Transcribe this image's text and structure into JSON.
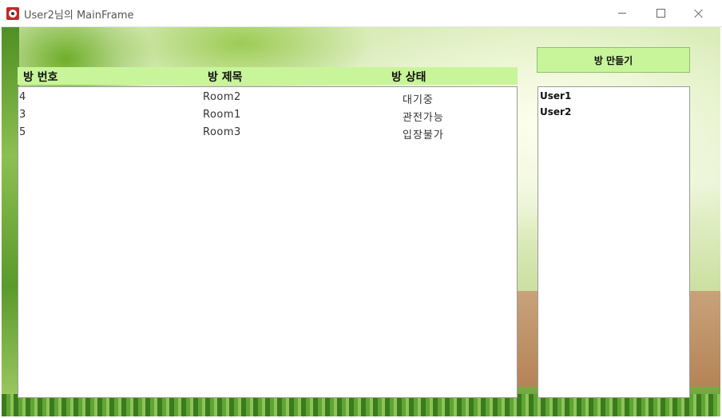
{
  "window": {
    "title": "User2님의 MainFrame",
    "icons": [
      "app-icon",
      "minimize-icon",
      "maximize-icon",
      "close-icon"
    ]
  },
  "room_table": {
    "headers": [
      "방 번호",
      "방 제목",
      "방 상태"
    ],
    "rows": [
      {
        "num": "4",
        "title": "Room2",
        "status": "대기중"
      },
      {
        "num": "3",
        "title": "Room1",
        "status": "관전가능"
      },
      {
        "num": "5",
        "title": "Room3",
        "status": "입장불가"
      }
    ]
  },
  "sidebar": {
    "make_room_label": "방 만들기",
    "users": [
      "User1",
      "User2"
    ]
  },
  "colors": {
    "header_bg": "#c8f59a",
    "button_bg": "#c8f59a"
  }
}
